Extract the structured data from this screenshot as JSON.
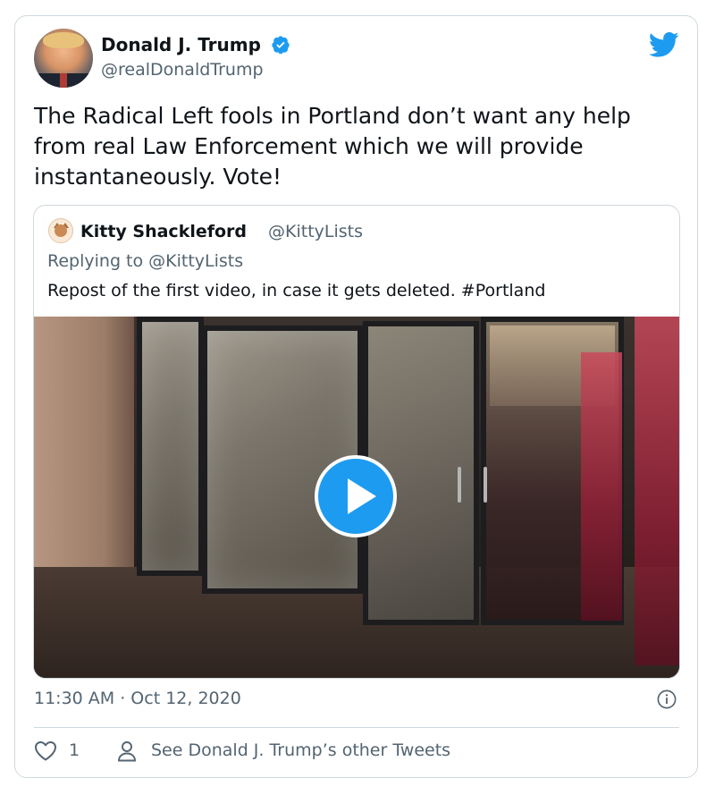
{
  "author": {
    "name": "Donald J. Trump",
    "handle": "@realDonaldTrump",
    "verified": true
  },
  "tweet": {
    "text": "The Radical Left fools in Portland don’t want any help from real Law Enforcement which we will provide instantaneously. Vote!",
    "timestamp": "11:30 AM · Oct 12, 2020"
  },
  "quoted": {
    "name": "Kitty Shackleford",
    "handle": "@KittyLists",
    "reply_context": "Replying to @KittyLists",
    "text": "Repost of the first video, in case it gets deleted. #Portland"
  },
  "footer": {
    "like_count": "1",
    "other_tweets_label": "See Donald J. Trump’s other Tweets"
  },
  "colors": {
    "accent": "#1d9bf0",
    "text": "#0f1419",
    "muted": "#536471",
    "border": "#cfd9de"
  },
  "icons": [
    "twitter-bird-icon",
    "verified-badge-icon",
    "play-icon",
    "info-icon",
    "heart-icon",
    "person-icon"
  ]
}
